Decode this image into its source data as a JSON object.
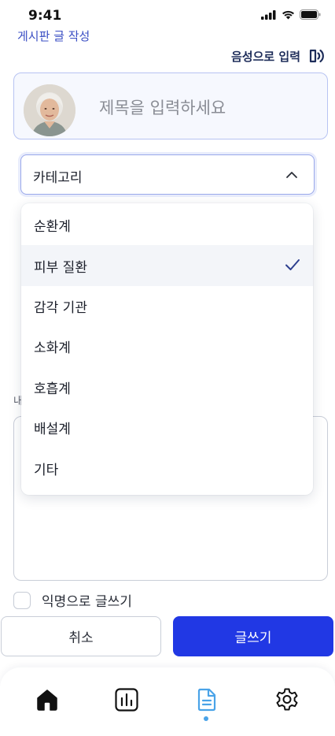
{
  "status_bar": {
    "time": "9:41"
  },
  "header": {
    "page_title": "게시판 글 작성",
    "voice_input_label": "음성으로 입력"
  },
  "title_field": {
    "placeholder": "제목을 입력하세요"
  },
  "category": {
    "label": "카테고리",
    "options": [
      {
        "label": "순환계",
        "selected": false
      },
      {
        "label": "피부 질환",
        "selected": true
      },
      {
        "label": "감각 기관",
        "selected": false
      },
      {
        "label": "소화계",
        "selected": false
      },
      {
        "label": "호흡계",
        "selected": false
      },
      {
        "label": "배설계",
        "selected": false
      },
      {
        "label": "기타",
        "selected": false
      }
    ]
  },
  "content_field": {
    "label": "내"
  },
  "anonymous": {
    "label": "익명으로 글쓰기",
    "checked": false
  },
  "actions": {
    "cancel_label": "취소",
    "submit_label": "글쓰기"
  },
  "nav": {
    "items": [
      {
        "icon": "home-icon",
        "active": false
      },
      {
        "icon": "bar-chart-icon",
        "active": false
      },
      {
        "icon": "document-icon",
        "active": true
      },
      {
        "icon": "gear-icon",
        "active": false
      }
    ]
  },
  "colors": {
    "accent": "#2138e4",
    "title_link": "#3b4fc4",
    "active_nav": "#4aa3e8"
  }
}
